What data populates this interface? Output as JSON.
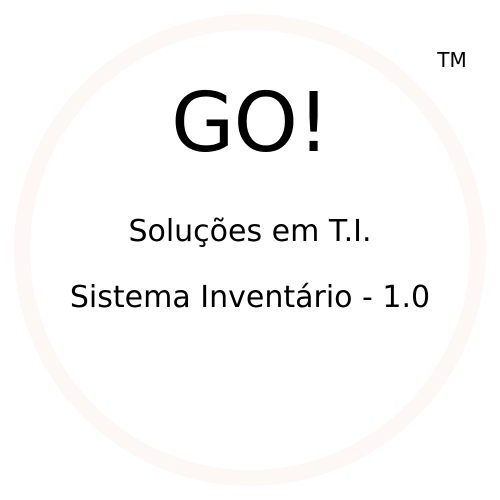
{
  "splash": {
    "logo_text": "GO!",
    "trademark": "TM",
    "subtitle": "Soluções em T.I.",
    "system_name": "Sistema Inventário - 1.0"
  },
  "colors": {
    "background": "#ffffff",
    "text": "#000000",
    "ring": "#fdf7f5"
  }
}
